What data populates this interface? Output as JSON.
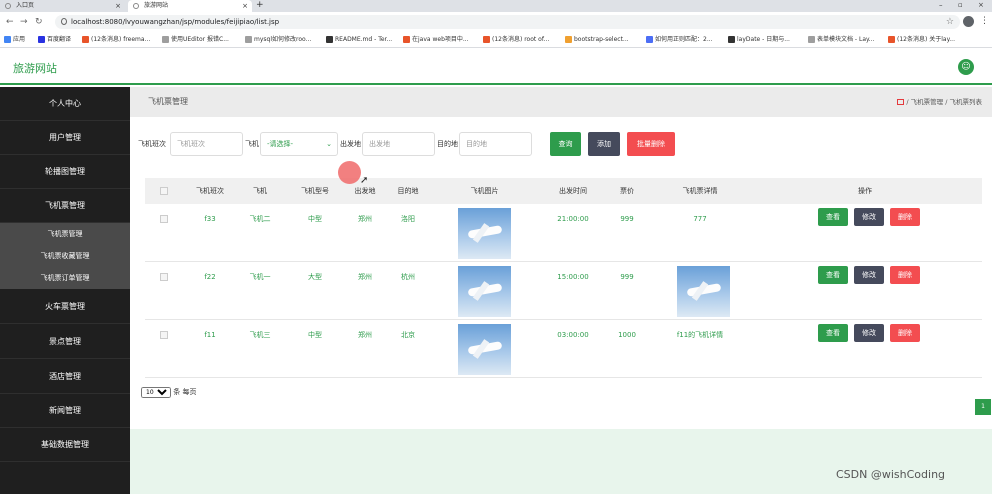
{
  "browser": {
    "tabs": [
      {
        "label": "入口页"
      },
      {
        "label": "旅游网站"
      }
    ],
    "new_tab": "+",
    "url": "localhost:8080/lvyouwangzhan/jsp/modules/feijipiao/list.jsp",
    "bookmarks": [
      {
        "label": "应用",
        "color": "#4285f4"
      },
      {
        "label": "百度翻译",
        "color": "#2932e1"
      },
      {
        "label": "(12条消息) freema...",
        "color": "#e8542a"
      },
      {
        "label": "使用UEditor 报错C...",
        "color": "#9e9e9e"
      },
      {
        "label": "mysql如何修改roo...",
        "color": "#9e9e9e"
      },
      {
        "label": "README.md - Ter...",
        "color": "#333333"
      },
      {
        "label": "在java web项目中...",
        "color": "#e8542a"
      },
      {
        "label": "(12条消息) root of...",
        "color": "#e8542a"
      },
      {
        "label": "bootstrap-select...",
        "color": "#f0a030"
      },
      {
        "label": "如何用正则匹配：2...",
        "color": "#4c6ef5"
      },
      {
        "label": "layDate - 日期与...",
        "color": "#333333"
      },
      {
        "label": "表单模块文档 - Lay...",
        "color": "#9e9e9e"
      },
      {
        "label": "(12条消息) 关于lay...",
        "color": "#e8542a"
      }
    ]
  },
  "app": {
    "brand": "旅游网站",
    "accent": "#2e9c4c"
  },
  "sidebar": {
    "items": [
      {
        "label": "个人中心"
      },
      {
        "label": "用户管理"
      },
      {
        "label": "轮播图管理"
      },
      {
        "label": "飞机票管理"
      }
    ],
    "subitems": [
      {
        "label": "飞机票管理"
      },
      {
        "label": "飞机票收藏管理"
      },
      {
        "label": "飞机票订单管理"
      }
    ],
    "items_after": [
      {
        "label": "火车票管理"
      },
      {
        "label": "景点管理"
      },
      {
        "label": "酒店管理"
      },
      {
        "label": "新闻管理"
      },
      {
        "label": "基础数据管理"
      }
    ]
  },
  "page": {
    "title": "飞机票管理",
    "breadcrumb": [
      "飞机票管理",
      "飞机票列表"
    ]
  },
  "search": {
    "flight_label": "飞机班次",
    "flight_placeholder": "飞机班次",
    "plane_label": "飞机",
    "plane_select": "-请选择-",
    "from_label": "出发地",
    "from_placeholder": "出发地",
    "to_label": "目的地",
    "to_placeholder": "目的地",
    "query_btn": "查询",
    "add_btn": "添加",
    "batch_delete_btn": "批量删除"
  },
  "table": {
    "headers": [
      "飞机班次",
      "飞机",
      "飞机型号",
      "出发地",
      "目的地",
      "飞机图片",
      "出发时间",
      "票价",
      "飞机票详情",
      "操作"
    ],
    "rows": [
      {
        "flight": "f33",
        "plane": "飞机二",
        "model": "中型",
        "from": "郑州",
        "to": "洛阳",
        "time": "21:00:00",
        "price": "999",
        "detail": "777",
        "detail_is_image": false
      },
      {
        "flight": "f22",
        "plane": "飞机一",
        "model": "大型",
        "from": "郑州",
        "to": "杭州",
        "time": "15:00:00",
        "price": "999",
        "detail": "",
        "detail_is_image": true
      },
      {
        "flight": "f11",
        "plane": "飞机三",
        "model": "中型",
        "from": "郑州",
        "to": "北京",
        "time": "03:00:00",
        "price": "1000",
        "detail": "f11的飞机详情",
        "detail_is_image": false
      }
    ],
    "actions": {
      "view": "查看",
      "edit": "修改",
      "delete": "删除"
    }
  },
  "pager": {
    "page_size": "10",
    "suffix": "条 每页",
    "current_page": "1"
  },
  "watermark": "CSDN @wishCoding"
}
